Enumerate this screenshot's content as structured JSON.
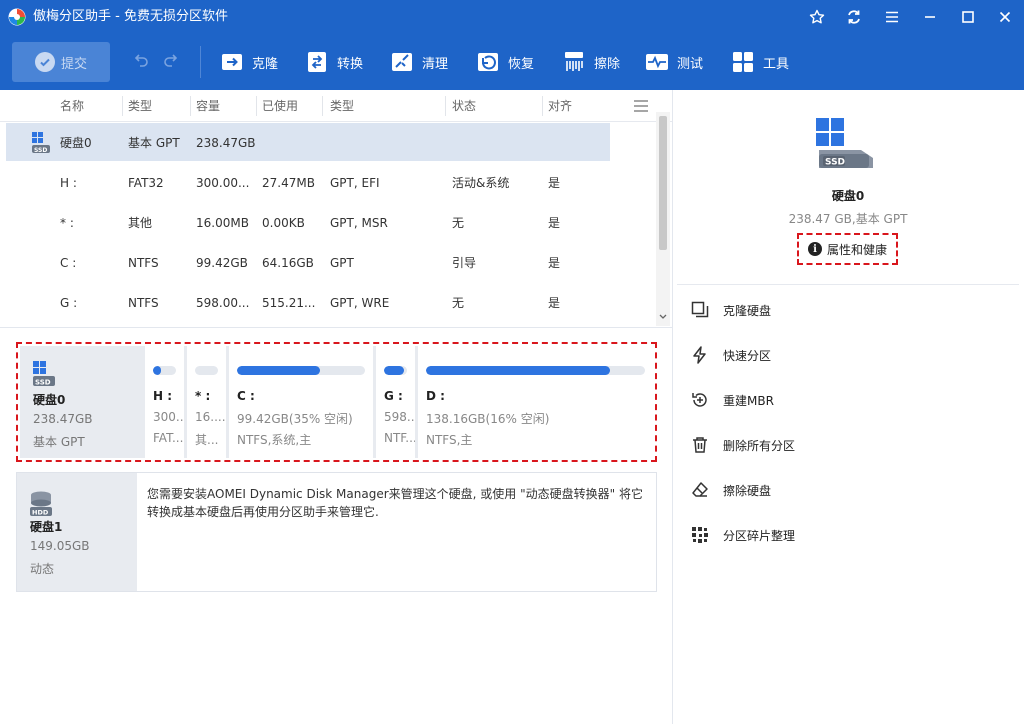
{
  "window": {
    "title": "傲梅分区助手 - 免费无损分区软件"
  },
  "toolbar": {
    "submit": "提交",
    "buttons": [
      "克隆",
      "转换",
      "清理",
      "恢复",
      "擦除",
      "测试",
      "工具"
    ]
  },
  "table": {
    "headers": [
      "名称",
      "类型",
      "容量",
      "已使用",
      "类型",
      "状态",
      "对齐"
    ],
    "disk_row": {
      "name": "硬盘0",
      "type": "基本 GPT",
      "capacity": "238.47GB"
    },
    "rows": [
      {
        "name": "H :",
        "fs": "FAT32",
        "capacity": "300.00...",
        "used": "27.47MB",
        "type": "GPT, EFI",
        "status": "活动&系统",
        "align": "是"
      },
      {
        "name": "* :",
        "fs": "其他",
        "capacity": "16.00MB",
        "used": "0.00KB",
        "type": "GPT, MSR",
        "status": "无",
        "align": "是"
      },
      {
        "name": "C :",
        "fs": "NTFS",
        "capacity": "99.42GB",
        "used": "64.16GB",
        "type": "GPT",
        "status": "引导",
        "align": "是"
      },
      {
        "name": "G :",
        "fs": "NTFS",
        "capacity": "598.00...",
        "used": "515.21...",
        "type": "GPT, WRE",
        "status": "无",
        "align": "是"
      }
    ]
  },
  "disk0_map": {
    "name": "硬盘0",
    "size": "238.47GB",
    "type": "基本 GPT",
    "partitions": [
      {
        "label": "H :",
        "size": "300...",
        "fs": "FAT...",
        "used_fraction": 0.35
      },
      {
        "label": "* :",
        "size": "16....",
        "fs": "其...",
        "used_fraction": 0
      },
      {
        "label": "C :",
        "size": "99.42GB(35% 空闲)",
        "fs": "NTFS,系统,主",
        "used_fraction": 0.65
      },
      {
        "label": "G :",
        "size": "598...",
        "fs": "NTF...",
        "used_fraction": 0.86
      },
      {
        "label": "D :",
        "size": "138.16GB(16% 空闲)",
        "fs": "NTFS,主",
        "used_fraction": 0.84
      }
    ]
  },
  "disk1_map": {
    "name": "硬盘1",
    "size": "149.05GB",
    "type": "动态",
    "message": "您需要安装AOMEI Dynamic Disk Manager来管理这个硬盘, 或使用 \"动态硬盘转换器\" 将它转换成基本硬盘后再使用分区助手来管理它."
  },
  "right_panel": {
    "disk_name": "硬盘0",
    "disk_info": "238.47 GB,基本 GPT",
    "properties": "属性和健康",
    "operations": [
      "克隆硬盘",
      "快速分区",
      "重建MBR",
      "删除所有分区",
      "擦除硬盘",
      "分区碎片整理"
    ]
  },
  "colors": {
    "title_bar": "#1e64c8",
    "accent": "#2e74e0",
    "highlight_border": "#d9161c"
  }
}
